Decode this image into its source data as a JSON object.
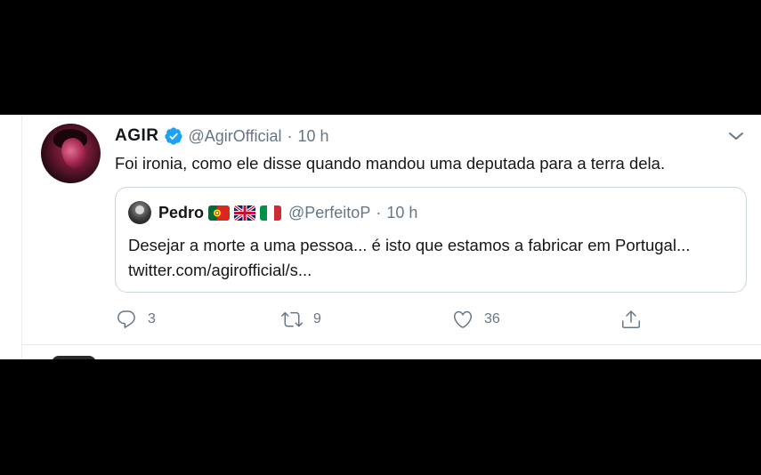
{
  "tweet": {
    "author_name": "AGIR",
    "handle": "@AgirOfficial",
    "separator": "·",
    "time": "10 h",
    "text": "Foi ironia, como ele disse quando mandou uma deputada para a terra dela.",
    "verified": true
  },
  "quoted": {
    "author_name": "Pedro",
    "flags": [
      "flag-portugal",
      "flag-united-kingdom",
      "flag-italy"
    ],
    "handle": "@PerfeitoP",
    "separator": "·",
    "time": "10 h",
    "text": "Desejar a morte a uma pessoa... é isto que estamos a fabricar em Portugal... twitter.com/agirofficial/s..."
  },
  "actions": {
    "reply_count": "3",
    "retweet_count": "9",
    "like_count": "36"
  },
  "colors": {
    "text_primary": "#14171a",
    "text_secondary": "#657786",
    "verified_blue": "#1da1f2",
    "border": "#ccd6dd",
    "divider": "#e6ecf0"
  }
}
